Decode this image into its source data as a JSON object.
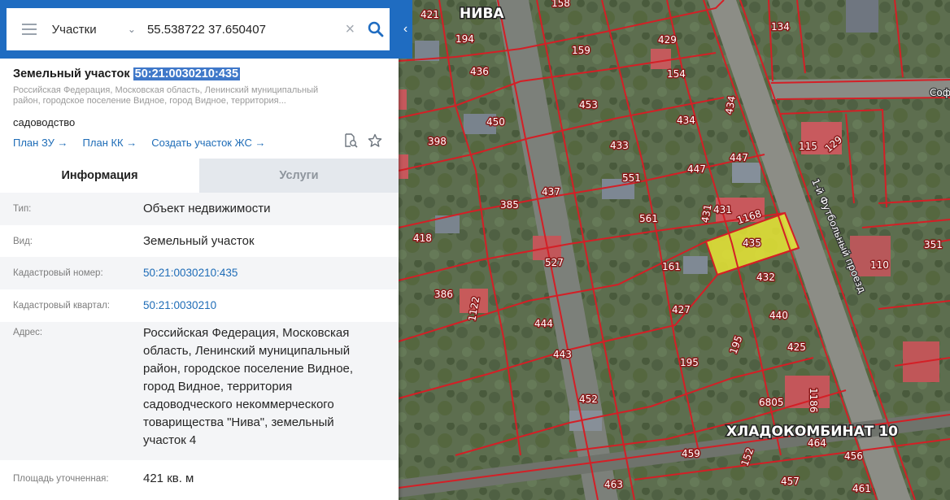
{
  "search": {
    "layer": "Участки",
    "query": "55.538722 37.650407"
  },
  "parcel": {
    "title_prefix": "Земельный участок",
    "cad_number": "50:21:0030210:435",
    "address_short_1": "Российская Федерация, Московская область, Ленинский муниципальный",
    "address_short_2": "район, городское поселение Видное, город Видное, территория...",
    "purpose": "садоводство",
    "links": [
      "План ЗУ →",
      "План КК →",
      "Создать участок ЖС →"
    ]
  },
  "tabs": [
    "Информация",
    "Услуги"
  ],
  "properties": [
    {
      "label": "Тип:",
      "value": "Объект недвижимости"
    },
    {
      "label": "Вид:",
      "value": "Земельный участок"
    },
    {
      "label": "Кадастровый номер:",
      "value": "50:21:0030210:435"
    },
    {
      "label": "Кадастровый квартал:",
      "value": "50:21:0030210"
    },
    {
      "label": "Адрес:",
      "value": "Российская Федерация, Московская область, Ленинский муниципальный район, городское поселение Видное, город Видное, территория садоводческого некоммерческого товарищества \"Нива\", земельный участок 4"
    },
    {
      "label": "Площадь уточненная:",
      "value": "421 кв. м"
    }
  ],
  "map": {
    "place_labels": [
      "НИВА",
      "ХЛАДОКОМБИНАТ 10"
    ],
    "road_label": "1-й Футбольный проезд",
    "edge_label": "Соф",
    "parcel_numbers": [
      "421",
      "194",
      "436",
      "450",
      "398",
      "385",
      "437",
      "418",
      "527",
      "386",
      "1122",
      "444",
      "443",
      "452",
      "459",
      "463",
      "158",
      "159",
      "453",
      "433",
      "551",
      "561",
      "161",
      "427",
      "195",
      "452",
      "429",
      "154",
      "434",
      "447",
      "447",
      "431",
      "1168",
      "435",
      "432",
      "440",
      "425",
      "6805",
      "1186",
      "464",
      "456",
      "457",
      "461",
      "134",
      "115",
      "129",
      "110",
      "351",
      "152",
      "195"
    ]
  },
  "colors": {
    "header_blue": "#1f6cc1",
    "boundary_red": "#d41f26",
    "selected_parcel": "#e8e635",
    "link_blue": "#1e6cb7"
  }
}
